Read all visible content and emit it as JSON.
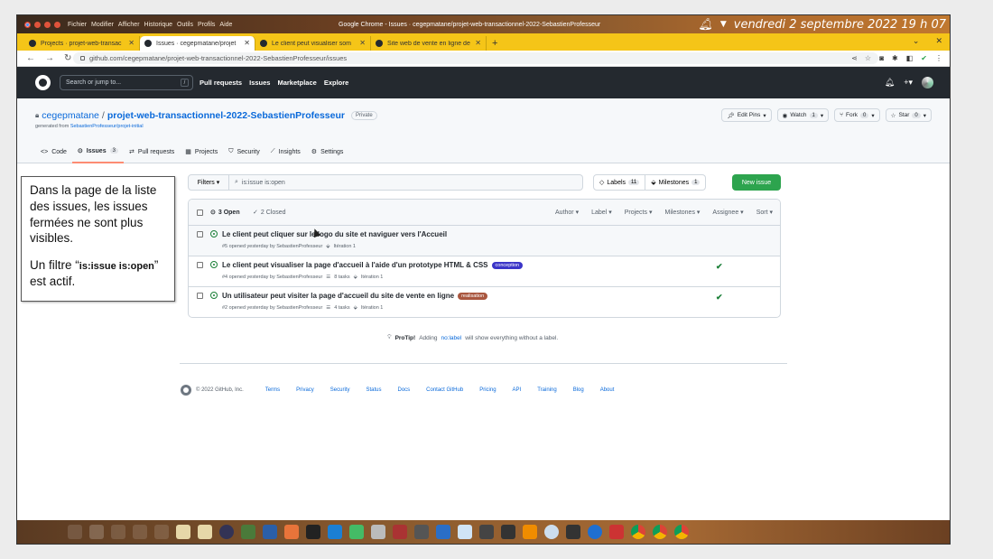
{
  "topbar": {
    "menus": [
      "Fichier",
      "Modifier",
      "Afficher",
      "Historique",
      "Outils",
      "Profils",
      "Aide"
    ],
    "window_title": "Google Chrome - Issues · cegepmatane/projet-web-transactionnel-2022-SebastienProfesseur",
    "datetime": "vendredi 2 septembre 2022  19 h 07"
  },
  "tabs": [
    {
      "label": "Projects · projet-web-transac"
    },
    {
      "label": "Issues · cegepmatane/projet"
    },
    {
      "label": "Le client peut visualiser som"
    },
    {
      "label": "Site web de vente en ligne de"
    }
  ],
  "address": {
    "url": "github.com/cegepmatane/projet-web-transactionnel-2022-SebastienProfesseur/issues"
  },
  "gh": {
    "search_placeholder": "Search or jump to...",
    "slash": "/",
    "nav": [
      "Pull requests",
      "Issues",
      "Marketplace",
      "Explore"
    ]
  },
  "repo": {
    "owner": "cegepmatane",
    "sep": "/",
    "name": "projet-web-transactionnel-2022-SebastienProfesseur",
    "visibility": "Private",
    "generated_prefix": "generated from ",
    "generated_link": "SebastienProfesseur/projet-initial",
    "buttons": {
      "edit_pins": "Edit Pins",
      "watch": "Watch",
      "watch_count": "1",
      "fork": "Fork",
      "fork_count": "0",
      "star": "Star",
      "star_count": "0"
    },
    "tabs": [
      {
        "label": "Code"
      },
      {
        "label": "Issues",
        "count": "3"
      },
      {
        "label": "Pull requests"
      },
      {
        "label": "Projects"
      },
      {
        "label": "Security"
      },
      {
        "label": "Insights"
      },
      {
        "label": "Settings"
      }
    ]
  },
  "issues": {
    "filters_label": "Filters",
    "query": "is:issue is:open",
    "labels_btn": "Labels",
    "labels_count": "11",
    "milestones_btn": "Milestones",
    "milestones_count": "1",
    "new_issue": "New issue",
    "open_count": "3 Open",
    "closed_count": "2 Closed",
    "sorts": [
      "Author",
      "Label",
      "Projects",
      "Milestones",
      "Assignee",
      "Sort"
    ],
    "list": [
      {
        "title": "Le client peut cliquer sur le logo du site et naviguer vers l'Accueil",
        "meta": "#5 opened yesterday by SebastienProfesseur",
        "iteration": "Itération 1"
      },
      {
        "title": "Le client peut visualiser la page d'accueil à l'aide d'un prototype HTML & CSS",
        "label": "conception",
        "label_color": "#3b35c8",
        "meta": "#4 opened yesterday by SebastienProfesseur",
        "tasks": "8 tasks",
        "iteration": "Itération 1"
      },
      {
        "title": "Un utilisateur peut visiter la page d'accueil du site de vente en ligne",
        "label": "realisation",
        "label_color": "#a9573f",
        "meta": "#2 opened yesterday by SebastienProfesseur",
        "tasks": "4 tasks",
        "iteration": "Itération 1"
      }
    ],
    "protip_bold": "ProTip!",
    "protip_text1": "Adding",
    "protip_kw": "no:label",
    "protip_text2": "will show everything without a label."
  },
  "footer": {
    "copyright": "© 2022 GitHub, Inc.",
    "links": [
      "Terms",
      "Privacy",
      "Security",
      "Status",
      "Docs",
      "Contact GitHub",
      "Pricing",
      "API",
      "Training",
      "Blog",
      "About"
    ]
  },
  "callout": {
    "line1": "Dans la page de la liste des issues, les issues fermées ne sont plus visibles.",
    "line2_prefix": "Un filtre “",
    "line2_bold": "is:issue is:open",
    "line2_suffix": "” est actif."
  },
  "colors": {
    "accent": "#0969da",
    "green": "#2da44e",
    "header": "#24292f",
    "tabbar": "#f5c518"
  }
}
